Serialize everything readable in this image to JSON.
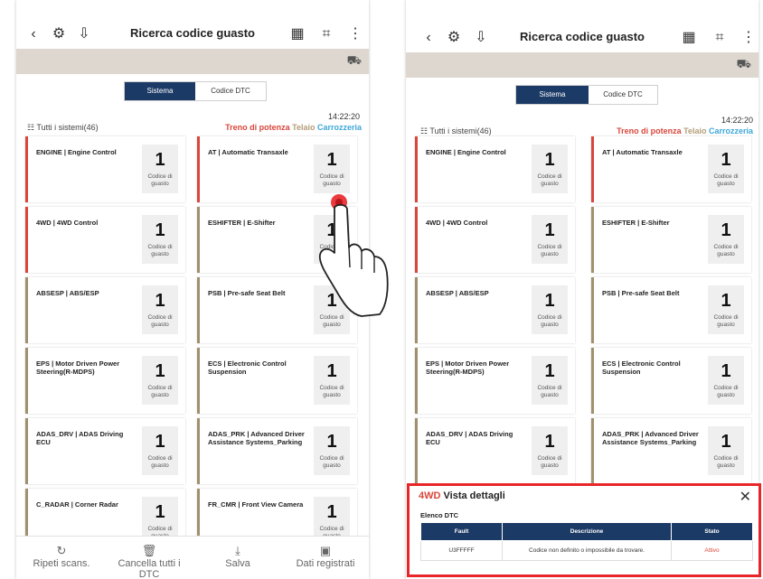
{
  "header": {
    "title": "Ricerca codice guasto",
    "icons": [
      "back-arrow-icon",
      "vehicle-scan-icon",
      "download-icon",
      "calendar-icon",
      "screenshot-icon",
      "more-menu-icon"
    ],
    "right_icon": "car-icon"
  },
  "segment": {
    "active": "Sistema",
    "inactive": "Codice DTC"
  },
  "time": "14:22:20",
  "systems_label": "Tutti i sistemi(46)",
  "categories": [
    {
      "label": "Treno di potenza",
      "color": "#d9463b"
    },
    {
      "label": "Telaio",
      "color": "#b59d78"
    },
    {
      "label": "Carrozzeria",
      "color": "#3da8d8"
    }
  ],
  "count_caption": "Codice di guasto",
  "cards_left": [
    {
      "name": "ENGINE | Engine Control",
      "count": "1",
      "accent": "#d9463b"
    },
    {
      "name": "AT | Automatic Transaxle",
      "count": "1",
      "accent": "#d9463b"
    },
    {
      "name": "4WD | 4WD Control",
      "count": "1",
      "accent": "#d9463b"
    },
    {
      "name": "ESHIFTER | E-Shifter",
      "count": "1",
      "accent": "#a0906e"
    },
    {
      "name": "ABSESP | ABS/ESP",
      "count": "1",
      "accent": "#a0906e"
    },
    {
      "name": "PSB | Pre-safe Seat Belt",
      "count": "1",
      "accent": "#a0906e"
    },
    {
      "name": "EPS | Motor Driven Power Steering(R-MDPS)",
      "count": "1",
      "accent": "#a0906e"
    },
    {
      "name": "ECS | Electronic Control Suspension",
      "count": "1",
      "accent": "#a0906e"
    },
    {
      "name": "ADAS_DRV | ADAS Driving ECU",
      "count": "1",
      "accent": "#a0906e"
    },
    {
      "name": "ADAS_PRK | Advanced Driver Assistance Systems_Parking",
      "count": "1",
      "accent": "#a0906e"
    },
    {
      "name": "C_RADAR | Corner Radar",
      "count": "1",
      "accent": "#a0906e"
    },
    {
      "name": "FR_CMR | Front View Camera",
      "count": "1",
      "accent": "#a0906e"
    }
  ],
  "bottom_bar": [
    {
      "label": "Ripeti scans.",
      "icon": "refresh-icon"
    },
    {
      "label": "Cancella tutti i DTC",
      "icon": "trash-icon"
    },
    {
      "label": "Salva",
      "icon": "save-icon"
    },
    {
      "label": "Dati registrati",
      "icon": "recorded-data-icon"
    }
  ],
  "details_panel": {
    "system": "4WD",
    "title": "Vista dettagli",
    "subtitle": "Elenco DTC",
    "columns": [
      "Fault",
      "Descrizione",
      "Stato"
    ],
    "rows": [
      {
        "fault": "U3FFFFF",
        "description": "Codice non definito o impossibile da trovare.",
        "status": "Attivo"
      }
    ],
    "border_color": "#e8262a"
  }
}
